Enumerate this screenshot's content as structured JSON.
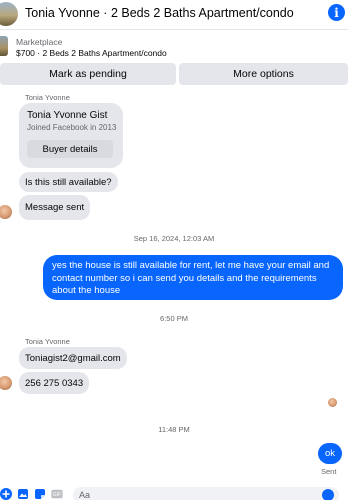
{
  "header": {
    "title": "Tonia Yvonne · 2 Beds 2 Baths Apartment/condo",
    "info_icon": "i"
  },
  "listing": {
    "source": "Marketplace",
    "detail": "$700 · 2 Beds 2 Baths Apartment/condo"
  },
  "actions": {
    "mark_pending": "Mark as pending",
    "more_options": "More options"
  },
  "messages": {
    "sender_name_1": "Tonia Yvonne",
    "gist_card": {
      "name": "Tonia Yvonne Gist",
      "joined": "Joined Facebook in 2013",
      "button": "Buyer details"
    },
    "still_available": "Is this still available?",
    "message_sent": "Message sent",
    "timestamp_1": "Sep 16, 2024, 12:03 AM",
    "outgoing_1": "yes the house is still available for rent, let me have your email  and contact number so i can send you details and the requirements about the house",
    "timestamp_2": "6:50 PM",
    "sender_name_2": "Tonia Yvonne",
    "email": "Toniagist2@gmail.com",
    "phone": "256 275 0343",
    "timestamp_3": "11:48 PM",
    "outgoing_2": "ok",
    "sent_status": "Sent"
  },
  "composer": {
    "placeholder": "Aa"
  },
  "colors": {
    "accent": "#0866ff",
    "bubble_gray": "#e4e6eb",
    "muted_text": "#65676b"
  }
}
